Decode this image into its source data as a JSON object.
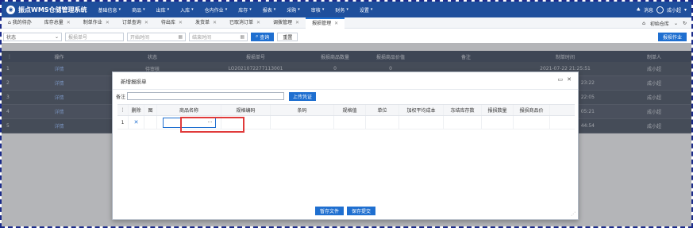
{
  "topnav": {
    "app_title": "振点WMS仓储管理系统",
    "menu": [
      "基础信息",
      "商品",
      "出库",
      "入库",
      "仓内作业",
      "库存",
      "报表",
      "采购",
      "审核",
      "财务",
      "设置"
    ],
    "notify_label": "消息",
    "user_label": "成小超"
  },
  "tabs": [
    {
      "label": "我的待办",
      "closable": false,
      "active": false
    },
    {
      "label": "库存总量",
      "closable": true,
      "active": false
    },
    {
      "label": "制单作业",
      "closable": true,
      "active": false
    },
    {
      "label": "订单查询",
      "closable": true,
      "active": false
    },
    {
      "label": "待出库",
      "closable": true,
      "active": false
    },
    {
      "label": "发货单",
      "closable": true,
      "active": false
    },
    {
      "label": "已取消订单",
      "closable": true,
      "active": false
    },
    {
      "label": "调拨管理",
      "closable": true,
      "active": false
    },
    {
      "label": "报损管理",
      "closable": true,
      "active": true
    }
  ],
  "tab_right": {
    "warehouse": "初始仓库"
  },
  "filter": {
    "status_select": "状态",
    "order_no_placeholder": "报损单号",
    "start_time_placeholder": "开始时间",
    "end_time_placeholder": "结束时间",
    "query_button": "查询",
    "reset_button": "重置",
    "action_button": "报损作业"
  },
  "main_table": {
    "headers": [
      "操作",
      "状态",
      "报损单号",
      "报损商品数量",
      "报损商品价值",
      "备注",
      "制单时间",
      "制单人"
    ],
    "rows": [
      {
        "no": "1",
        "op": "详情",
        "status": "待审核",
        "order": "LO2021072277113001",
        "qty": "0",
        "value": "0",
        "remark": "",
        "time": "2021-07-22 21:25:51",
        "user": "成小超"
      },
      {
        "no": "2",
        "op": "详情",
        "status": "",
        "order": "",
        "qty": "",
        "value": "",
        "remark": "",
        "time": "23:22",
        "user": "成小超"
      },
      {
        "no": "3",
        "op": "详情",
        "status": "",
        "order": "",
        "qty": "",
        "value": "",
        "remark": "",
        "time": "22:05",
        "user": "成小超"
      },
      {
        "no": "4",
        "op": "详情",
        "status": "",
        "order": "",
        "qty": "",
        "value": "",
        "remark": "",
        "time": "05:21",
        "user": "成小超"
      },
      {
        "no": "5",
        "op": "详情",
        "status": "",
        "order": "",
        "qty": "",
        "value": "",
        "remark": "",
        "time": "44:54",
        "user": "成小超"
      }
    ]
  },
  "modal": {
    "title": "新增报损单",
    "remark_label": "备注",
    "upload_button": "上传凭证",
    "headers": [
      "删除",
      "图",
      "商品名称",
      "规格编码",
      "条码",
      "规格值",
      "单位",
      "加权平均成本",
      "冻结库存数",
      "报损数量",
      "报损商品价"
    ],
    "rows": [
      {
        "no": "1",
        "name_value": "···"
      }
    ],
    "save_draft_button": "暂存文件",
    "submit_button": "保存提交"
  },
  "colors": {
    "nav": "#1f4f9c",
    "accent": "#1f6fd0",
    "highlight": "#e03a3a"
  }
}
